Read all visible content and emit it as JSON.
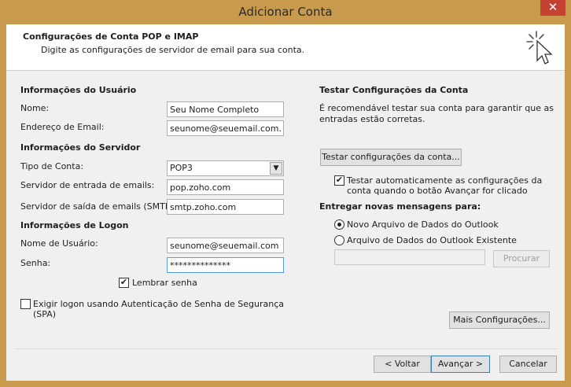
{
  "window": {
    "title": "Adicionar Conta",
    "close_glyph": "✕"
  },
  "header": {
    "title": "Configurações de Conta POP e IMAP",
    "subtitle": "Digite as configurações de servidor de email para sua conta."
  },
  "user_info": {
    "section": "Informações do Usuário",
    "name_label": "Nome:",
    "name_value": "Seu Nome Completo",
    "email_label": "Endereço de Email:",
    "email_value": "seunome@seuemail.com.br"
  },
  "server_info": {
    "section": "Informações do Servidor",
    "account_type_label": "Tipo de Conta:",
    "account_type_value": "POP3",
    "incoming_label": "Servidor de entrada de emails:",
    "incoming_value": "pop.zoho.com",
    "outgoing_label": "Servidor de saída de emails (SMTP):",
    "outgoing_value": "smtp.zoho.com"
  },
  "logon_info": {
    "section": "Informações de Logon",
    "username_label": "Nome de Usuário:",
    "username_value": "seunome@seuemail.com",
    "password_label": "Senha:",
    "password_value": "**************",
    "remember_label": "Lembrar senha",
    "remember_checked": true,
    "spa_label_line1": "Exigir logon usando Autenticação de Senha de Segurança",
    "spa_label_line2": "(SPA)",
    "spa_checked": false
  },
  "test": {
    "section": "Testar Configurações da Conta",
    "description_line1": "É recomendável testar sua conta para garantir que as",
    "description_line2": "entradas estão corretas.",
    "test_button": "Testar configurações da conta...",
    "auto_test_line1": "Testar automaticamente as configurações da",
    "auto_test_line2": "conta quando o botão Avançar for clicado",
    "auto_test_checked": true
  },
  "delivery": {
    "section": "Entregar novas mensagens para:",
    "option_new": "Novo Arquivo de Dados do Outlook",
    "option_existing": "Arquivo de Dados do Outlook Existente",
    "selected": "new",
    "path_value": "",
    "browse_button": "Procurar"
  },
  "more_settings_button": "Mais Configurações...",
  "footer": {
    "back": "< Voltar",
    "next": "Avançar >",
    "cancel": "Cancelar"
  },
  "colors": {
    "frame": "#c79a4e",
    "close": "#c54131",
    "face": "#f0f0f0"
  }
}
